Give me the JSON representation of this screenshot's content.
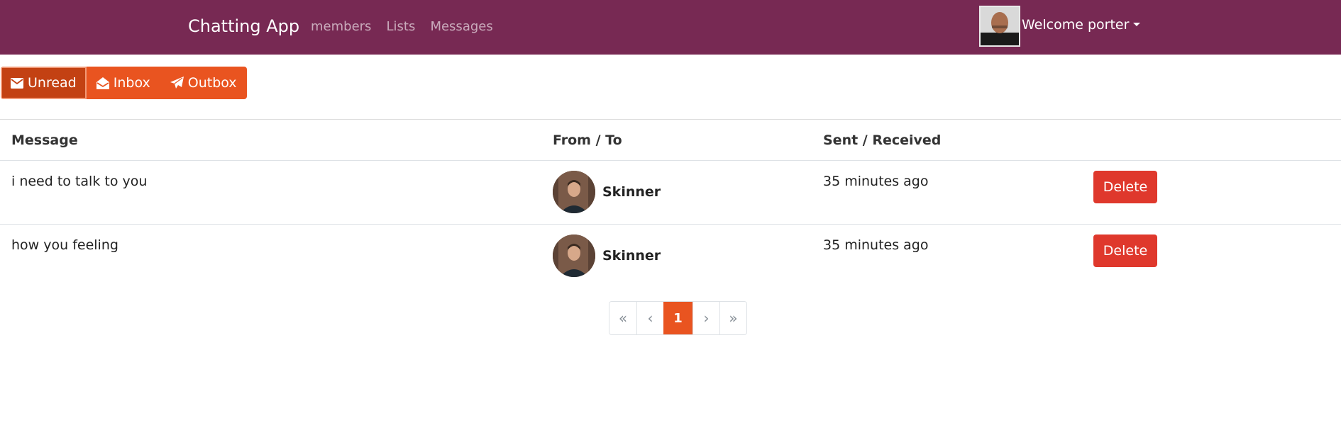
{
  "navbar": {
    "brand": "Chatting App",
    "links": [
      "members",
      "Lists",
      "Messages"
    ],
    "welcome": "Welcome porter",
    "colors": {
      "bar": "#772953",
      "accent": "#E95420",
      "danger": "#DF382C"
    }
  },
  "tabs": [
    {
      "label": "Unread",
      "icon": "envelope-icon",
      "active": true
    },
    {
      "label": "Inbox",
      "icon": "envelope-open-icon",
      "active": false
    },
    {
      "label": "Outbox",
      "icon": "paper-plane-icon",
      "active": false
    }
  ],
  "table": {
    "headers": [
      "Message",
      "From / To",
      "Sent / Received"
    ],
    "rows": [
      {
        "message": "i need to talk to you",
        "name": "Skinner",
        "time": "35 minutes ago",
        "action": "Delete"
      },
      {
        "message": "how you feeling",
        "name": "Skinner",
        "time": "35 minutes ago",
        "action": "Delete"
      }
    ]
  },
  "pagination": {
    "first": "«",
    "prev": "‹",
    "current": "1",
    "next": "›",
    "last": "»"
  }
}
